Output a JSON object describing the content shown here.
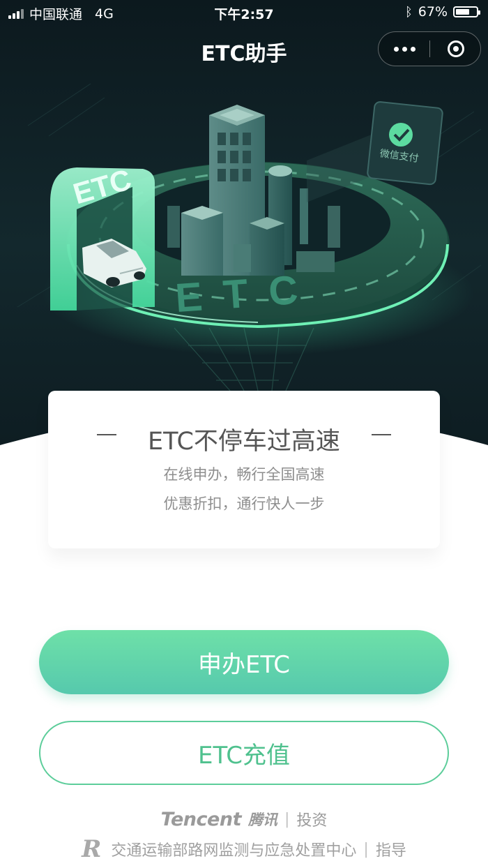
{
  "status_bar": {
    "carrier": "中国联通",
    "network": "4G",
    "time": "下午2:57",
    "battery": "67%",
    "battery_level": 0.67
  },
  "nav": {
    "title": "ETC助手"
  },
  "hero": {
    "sign_text": "ETC",
    "road_text": "ETC",
    "billboard_text": "微信支付"
  },
  "card": {
    "headline": "ETC不停车过高速",
    "line1": "在线申办，畅行全国高速",
    "line2": "优惠折扣，通行快人一步"
  },
  "buttons": {
    "apply": "申办ETC",
    "recharge": "ETC充值"
  },
  "footer": {
    "tencent_logo": "Tencent",
    "tencent_cn": "腾讯",
    "invest": "投资",
    "ministry_logo": "R",
    "ministry": "交通运输部路网监测与应急处置中心",
    "guide": "指导"
  },
  "colors": {
    "hero_bg": "#0f1e24",
    "accent": "#5ccd9a",
    "button_gradient_top": "#6ee0a8",
    "button_gradient_bottom": "#56c9ad"
  }
}
